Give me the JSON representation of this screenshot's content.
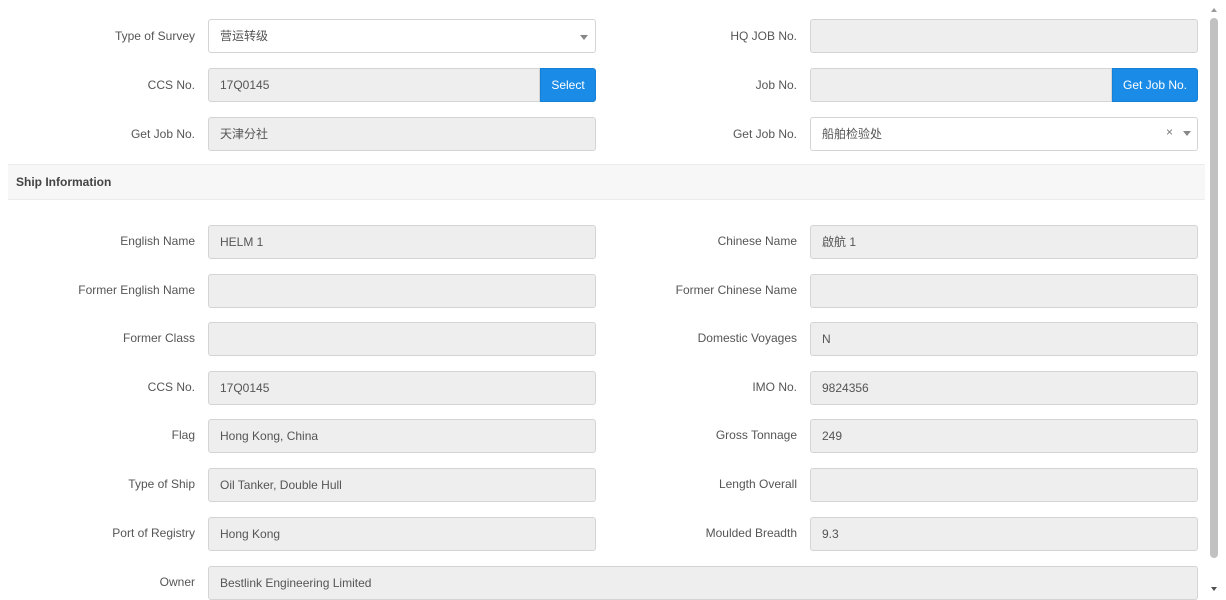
{
  "survey": {
    "type_of_survey": {
      "label": "Type of Survey",
      "value": "营运转级"
    },
    "hq_job_no": {
      "label": "HQ JOB No.",
      "value": ""
    },
    "ccs_no": {
      "label": "CCS No.",
      "value": "17Q0145",
      "button": "Select"
    },
    "job_no": {
      "label": "Job No.",
      "value": "",
      "button": "Get Job No."
    },
    "get_job_no_left": {
      "label": "Get Job No.",
      "value": "天津分社"
    },
    "get_job_no_right": {
      "label": "Get Job No.",
      "value": "船舶检验处",
      "clear": "×"
    }
  },
  "ship_information": {
    "title": "Ship Information",
    "english_name": {
      "label": "English Name",
      "value": "HELM 1"
    },
    "chinese_name": {
      "label": "Chinese Name",
      "value": "啟航 1"
    },
    "former_english_name": {
      "label": "Former English Name",
      "value": ""
    },
    "former_chinese_name": {
      "label": "Former Chinese Name",
      "value": ""
    },
    "former_class": {
      "label": "Former Class",
      "value": ""
    },
    "domestic_voyages": {
      "label": "Domestic Voyages",
      "value": "N"
    },
    "ccs_no": {
      "label": "CCS No.",
      "value": "17Q0145"
    },
    "imo_no": {
      "label": "IMO No.",
      "value": "9824356"
    },
    "flag": {
      "label": "Flag",
      "value": "Hong Kong, China"
    },
    "gross_tonnage": {
      "label": "Gross Tonnage",
      "value": "249"
    },
    "type_of_ship": {
      "label": "Type of Ship",
      "value": "Oil Tanker, Double Hull"
    },
    "length_overall": {
      "label": "Length Overall",
      "value": ""
    },
    "port_of_registry": {
      "label": "Port of Registry",
      "value": "Hong Kong"
    },
    "moulded_breadth": {
      "label": "Moulded Breadth",
      "value": "9.3"
    },
    "owner": {
      "label": "Owner",
      "value": "Bestlink Engineering Limited"
    }
  },
  "colors": {
    "accent": "#1a8be6",
    "readonly_field": "#eeeeee",
    "section_bg": "#f7f7f7"
  },
  "icons": [
    "chevron-down-icon",
    "clear-icon",
    "scroll-up-arrow-icon",
    "scroll-down-arrow-icon"
  ]
}
